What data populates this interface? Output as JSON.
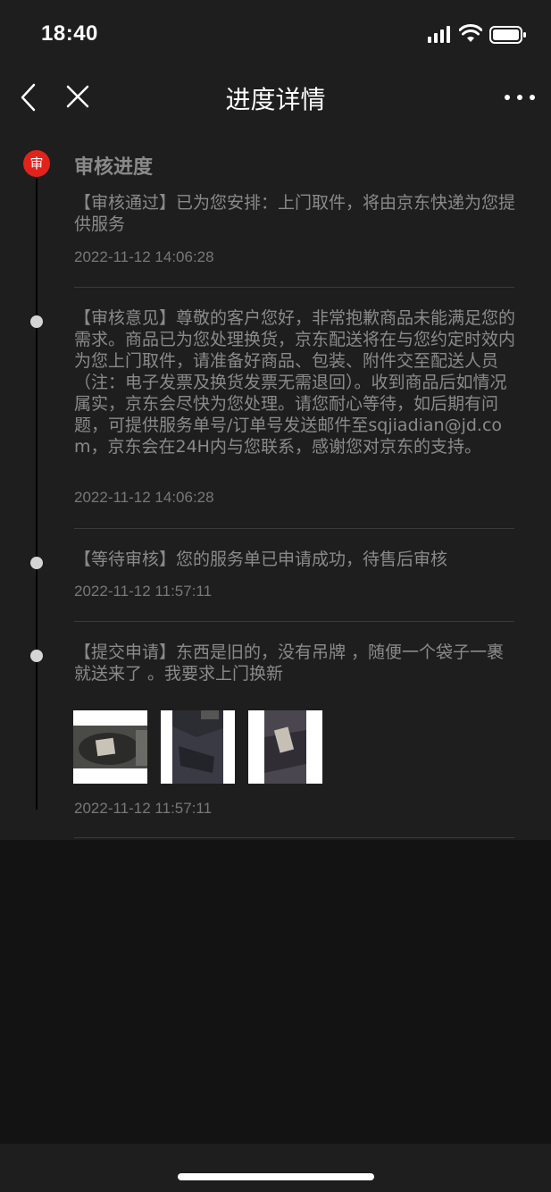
{
  "status_bar": {
    "time": "18:40"
  },
  "nav": {
    "title": "进度详情"
  },
  "section": {
    "badge": "审",
    "title": "审核进度"
  },
  "entries": [
    {
      "text": "【审核通过】已为您安排：上门取件，将由京东快递为您提供服务",
      "time": "2022-11-12 14:06:28"
    },
    {
      "text": "【审核意见】尊敬的客户您好，非常抱歉商品未能满足您的需求。商品已为您处理换货，京东配送将在与您约定时效内为您上门取件，请准备好商品、包装、附件交至配送人员（注：电子发票及换货发票无需退回）。收到商品后如情况属实，京东会尽快为您处理。请您耐心等待，如后期有问题，可提供服务单号/订单号发送邮件至sqjiadian@jd.com，京东会在24H内与您联系，感谢您对京东的支持。",
      "time": "2022-11-12 14:06:28"
    },
    {
      "text": "【等待审核】您的服务单已申请成功，待售后审核",
      "time": "2022-11-12 11:57:11"
    },
    {
      "text": "【提交申请】东西是旧的，没有吊牌 ，随便一个袋子一裹就送来了 。我要求上门换新",
      "time": "2022-11-12 11:57:11"
    }
  ],
  "icons": {
    "back": "chevron-left-icon",
    "close": "close-icon",
    "more": "more-dots-icon",
    "signal": "cellular-signal-icon",
    "wifi": "wifi-icon",
    "battery": "battery-icon"
  },
  "colors": {
    "accent": "#e2231a",
    "background": "#1f1e1f",
    "text": "#8a8a8a"
  }
}
